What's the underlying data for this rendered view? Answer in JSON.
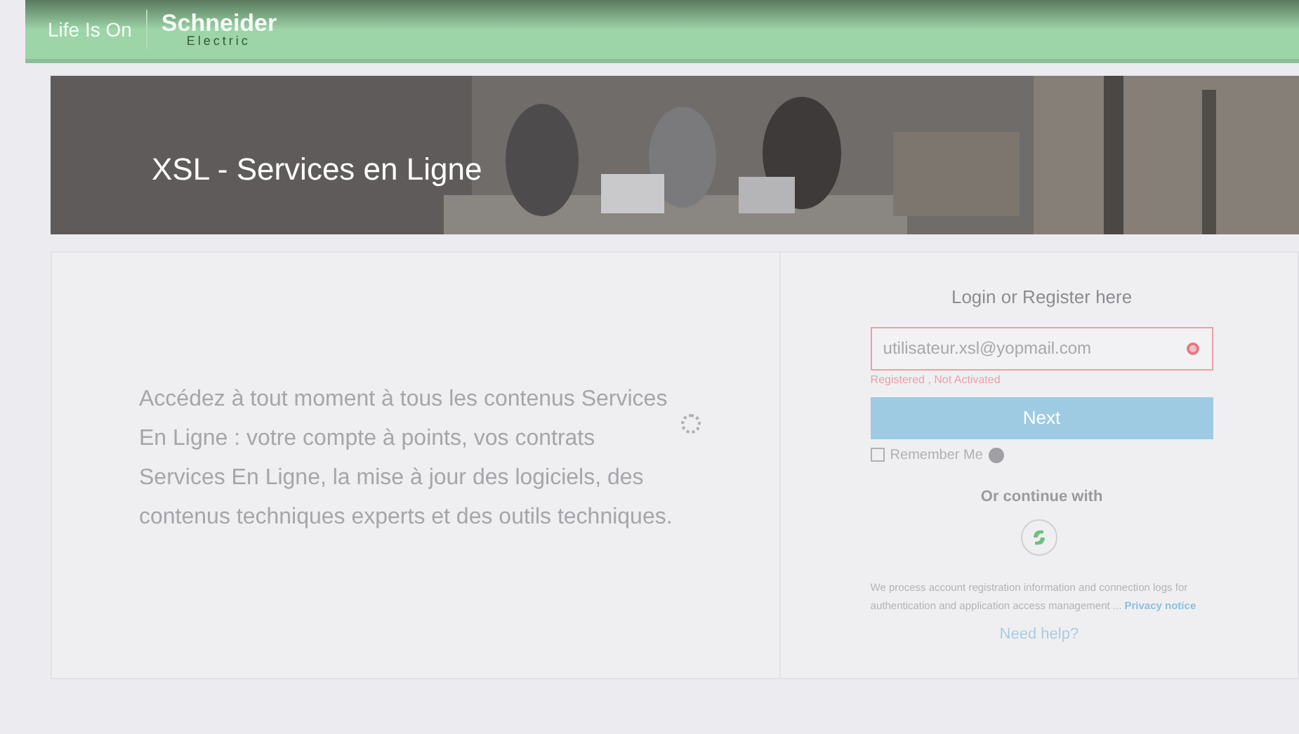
{
  "header": {
    "tagline": "Life Is On",
    "brand": "Schneider",
    "brand_sub": "Electric"
  },
  "banner": {
    "kind": "picture",
    "title": "XSL - Services en Ligne"
  },
  "intro": "Accédez à tout moment à tous les contenus Services En Ligne : votre compte à points, vos contrats Services En Ligne, la mise à jour des logiciels, des contenus techniques experts et des outils techniques.",
  "login": {
    "heading": "Login or Register here",
    "email": {
      "value": "utilisateur.xsl@yopmail.com",
      "error": "Registered , Not Activated"
    },
    "next_button": "Next",
    "remember": {
      "label": "Remember Me",
      "checked": false
    },
    "continue_with": "Or continue with",
    "notice": "We process account registration information and connection logs for authentication and application access management ...",
    "privacy_link": "Privacy notice",
    "help_link": "Need help?"
  }
}
